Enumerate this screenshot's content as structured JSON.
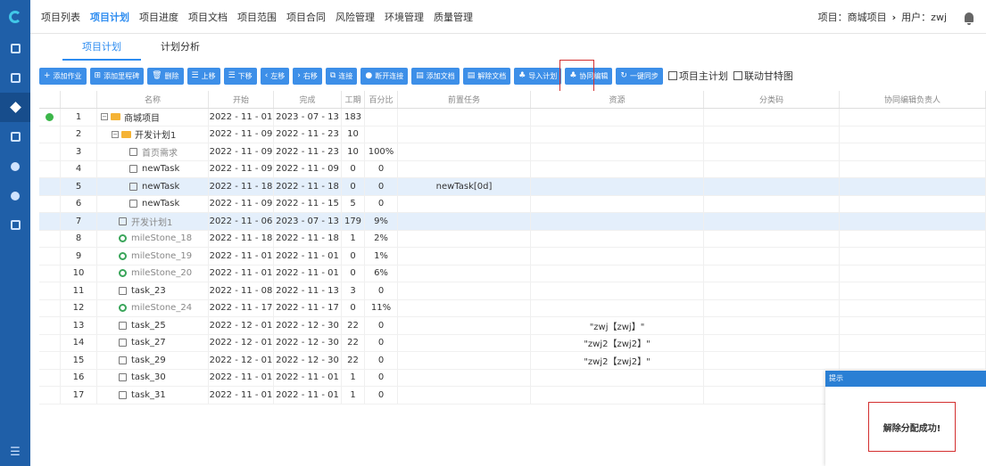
{
  "nav": {
    "items": [
      "项目列表",
      "项目计划",
      "项目进度",
      "项目文档",
      "项目范围",
      "项目合同",
      "风险管理",
      "环境管理",
      "质量管理"
    ],
    "active": "项目计划",
    "project_label": "项目：商城项目",
    "user_label": "用户：zwj"
  },
  "subtabs": [
    "项目计划",
    "计划分析"
  ],
  "toolbar": {
    "buttons": [
      {
        "icon": "+",
        "label": "添加作业"
      },
      {
        "icon": "⊞",
        "label": "添加里程碑"
      },
      {
        "icon": "🗑",
        "label": "删除"
      },
      {
        "icon": "☰",
        "label": "上移"
      },
      {
        "icon": "☰",
        "label": "下移"
      },
      {
        "icon": "‹",
        "label": "左移"
      },
      {
        "icon": "›",
        "label": "右移"
      },
      {
        "icon": "⧉",
        "label": "连接"
      },
      {
        "icon": "●",
        "label": "断开连接"
      },
      {
        "icon": "▤",
        "label": "添加文档"
      },
      {
        "icon": "▤",
        "label": "解除文档"
      },
      {
        "icon": "♣",
        "label": "导入计划"
      },
      {
        "icon": "♣",
        "label": "协同编辑"
      },
      {
        "icon": "↻",
        "label": "一键同步"
      }
    ],
    "checkbox_main": "项目主计划",
    "checkbox_gantt": "联动甘特图"
  },
  "table": {
    "headers": [
      "名称",
      "开始",
      "完成",
      "工期",
      "百分比",
      "前置任务",
      "资源",
      "分类码",
      "协同编辑负责人"
    ],
    "rows": [
      {
        "num": "1",
        "name": "商城项目",
        "start": "2022 - 11 - 01",
        "end": "2023 - 07 - 13",
        "dur": "183",
        "pct": "",
        "pre": "",
        "res": "",
        "kind": "folder",
        "indent": 0,
        "toggle": "−",
        "status": true
      },
      {
        "num": "2",
        "name": "开发计划1",
        "start": "2022 - 11 - 09",
        "end": "2022 - 11 - 23",
        "dur": "10",
        "pct": "",
        "pre": "",
        "res": "",
        "kind": "folder",
        "indent": 12,
        "toggle": "−"
      },
      {
        "num": "3",
        "name": "首页需求",
        "start": "2022 - 11 - 09",
        "end": "2022 - 11 - 23",
        "dur": "10",
        "pct": "100%",
        "pre": "",
        "res": "",
        "kind": "task",
        "indent": 32,
        "gray": true
      },
      {
        "num": "4",
        "name": "newTask",
        "start": "2022 - 11 - 09",
        "end": "2022 - 11 - 09",
        "dur": "0",
        "pct": "0",
        "pre": "",
        "res": "",
        "kind": "task",
        "indent": 32
      },
      {
        "num": "5",
        "name": "newTask",
        "start": "2022 - 11 - 18",
        "end": "2022 - 11 - 18",
        "dur": "0",
        "pct": "0",
        "pre": "newTask[0d]",
        "res": "",
        "kind": "task",
        "indent": 32,
        "sel": true
      },
      {
        "num": "6",
        "name": "newTask",
        "start": "2022 - 11 - 09",
        "end": "2022 - 11 - 15",
        "dur": "5",
        "pct": "0",
        "pre": "",
        "res": "",
        "kind": "task",
        "indent": 32
      },
      {
        "num": "7",
        "name": "开发计划1",
        "start": "2022 - 11 - 06",
        "end": "2023 - 07 - 13",
        "dur": "179",
        "pct": "9%",
        "pre": "",
        "res": "",
        "kind": "task",
        "indent": 20,
        "sel": true,
        "gray": true
      },
      {
        "num": "8",
        "name": "mileStone_18",
        "start": "2022 - 11 - 18",
        "end": "2022 - 11 - 18",
        "dur": "1",
        "pct": "2%",
        "pre": "",
        "res": "",
        "kind": "milestone",
        "indent": 20,
        "gray": true
      },
      {
        "num": "9",
        "name": "mileStone_19",
        "start": "2022 - 11 - 01",
        "end": "2022 - 11 - 01",
        "dur": "0",
        "pct": "1%",
        "pre": "",
        "res": "",
        "kind": "milestone",
        "indent": 20,
        "gray": true
      },
      {
        "num": "10",
        "name": "mileStone_20",
        "start": "2022 - 11 - 01",
        "end": "2022 - 11 - 01",
        "dur": "0",
        "pct": "6%",
        "pre": "",
        "res": "",
        "kind": "milestone",
        "indent": 20,
        "gray": true
      },
      {
        "num": "11",
        "name": "task_23",
        "start": "2022 - 11 - 08",
        "end": "2022 - 11 - 13",
        "dur": "3",
        "pct": "0",
        "pre": "",
        "res": "",
        "kind": "task",
        "indent": 20
      },
      {
        "num": "12",
        "name": "mileStone_24",
        "start": "2022 - 11 - 17",
        "end": "2022 - 11 - 17",
        "dur": "0",
        "pct": "11%",
        "pre": "",
        "res": "",
        "kind": "milestone",
        "indent": 20,
        "gray": true
      },
      {
        "num": "13",
        "name": "task_25",
        "start": "2022 - 12 - 01",
        "end": "2022 - 12 - 30",
        "dur": "22",
        "pct": "0",
        "pre": "",
        "res": "\"zwj【zwj】\"",
        "kind": "task",
        "indent": 20
      },
      {
        "num": "14",
        "name": "task_27",
        "start": "2022 - 12 - 01",
        "end": "2022 - 12 - 30",
        "dur": "22",
        "pct": "0",
        "pre": "",
        "res": "\"zwj2【zwj2】\"",
        "kind": "task",
        "indent": 20
      },
      {
        "num": "15",
        "name": "task_29",
        "start": "2022 - 12 - 01",
        "end": "2022 - 12 - 30",
        "dur": "22",
        "pct": "0",
        "pre": "",
        "res": "\"zwj2【zwj2】\"",
        "kind": "task",
        "indent": 20
      },
      {
        "num": "16",
        "name": "task_30",
        "start": "2022 - 11 - 01",
        "end": "2022 - 11 - 01",
        "dur": "1",
        "pct": "0",
        "pre": "",
        "res": "",
        "kind": "task",
        "indent": 20
      },
      {
        "num": "17",
        "name": "task_31",
        "start": "2022 - 11 - 01",
        "end": "2022 - 11 - 01",
        "dur": "1",
        "pct": "0",
        "pre": "",
        "res": "",
        "kind": "task",
        "indent": 20
      }
    ]
  },
  "toast": {
    "title": "提示",
    "message": "解除分配成功!"
  },
  "colors": {
    "sidebar": "#1f5fa8",
    "accent": "#2d8cf0",
    "button": "#3d8fe8",
    "highlight": "#d32f2f"
  }
}
